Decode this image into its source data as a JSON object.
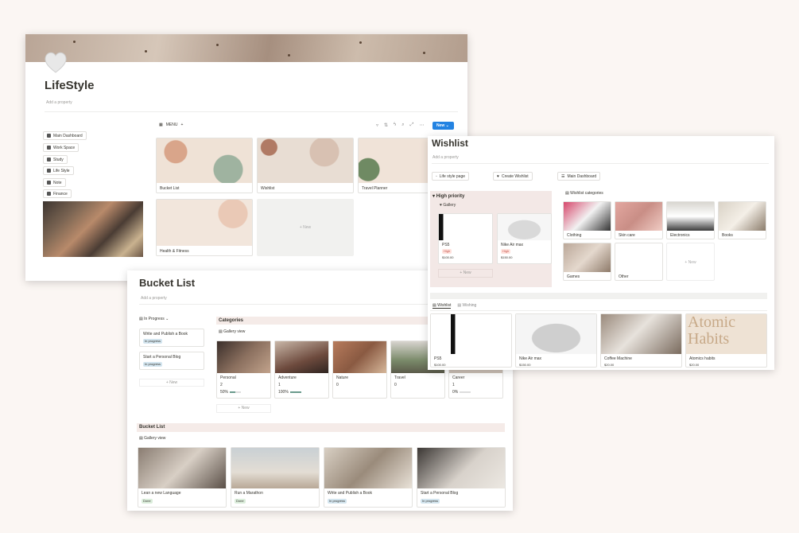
{
  "lifestyle": {
    "title": "LifeStyle",
    "add_property": "Add a property",
    "menu_label": "MENU",
    "new_btn": "New",
    "nav": [
      "Main Dashboard",
      "Work Space",
      "Study",
      "Life Style",
      "Note",
      "Finance"
    ],
    "cards": [
      "Bucket List",
      "Wishlist",
      "Travel Planner",
      "Health & Fitness"
    ],
    "new_card": "+ New"
  },
  "bucket": {
    "title": "Bucket List",
    "add_property": "Add a property",
    "in_progress": "In Progress",
    "progress_items": [
      {
        "title": "Write and Publish a Book",
        "status": "In progress"
      },
      {
        "title": "Start a Personal Blog",
        "status": "In progress"
      }
    ],
    "new_label": "+ New",
    "categories_title": "Categories",
    "gallery_view": "Gallery view",
    "categories": [
      {
        "name": "Personal",
        "count": "2",
        "pct": "50%"
      },
      {
        "name": "Adventure",
        "count": "1",
        "pct": "100%"
      },
      {
        "name": "Nature",
        "count": "0",
        "pct": ""
      },
      {
        "name": "Travel",
        "count": "0",
        "pct": ""
      },
      {
        "name": "Career",
        "count": "1",
        "pct": "0%"
      }
    ],
    "list_title": "Bucket List",
    "list_view": "Gallery view",
    "items": [
      {
        "name": "Lean a new Language",
        "status": "Done"
      },
      {
        "name": "Run a Marathon",
        "status": "Done"
      },
      {
        "name": "Write and Publish a Book",
        "status": "In progress"
      },
      {
        "name": "Start a Personal Blog",
        "status": "In progress"
      }
    ]
  },
  "wishlist": {
    "title": "Wishlist",
    "add_property": "Add a property",
    "buttons": [
      "Life style page",
      "Create Wishlist",
      "Main Dashboard"
    ],
    "priority_title": "High priority",
    "gallery": "Gallery",
    "priority_items": [
      {
        "name": "PS5",
        "tag": "High",
        "price": "$100.00"
      },
      {
        "name": "Nike Air max",
        "tag": "High",
        "price": "$150.00"
      }
    ],
    "new_label": "+ New",
    "categories_title": "Wishlist categories",
    "categories": [
      "Clothing",
      "Skin care",
      "Electronics",
      "Books",
      "Games",
      "Other"
    ],
    "tabs": [
      "Wishlist",
      "Wishing"
    ],
    "items": [
      {
        "name": "PS5",
        "price": "$100.00"
      },
      {
        "name": "Nike Air max",
        "price": "$150.00"
      },
      {
        "name": "Coffee Machine",
        "price": "$20.00"
      },
      {
        "name": "Atomics habits",
        "price": "$20.00"
      }
    ],
    "atomic_text": "Atomic Habits"
  }
}
